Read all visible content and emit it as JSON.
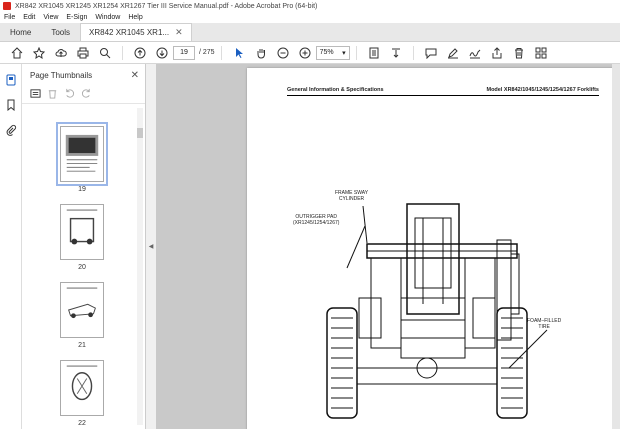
{
  "window": {
    "title": "XR842 XR1045 XR1245 XR1254 XR1267 Tier III Service Manual.pdf - Adobe Acrobat Pro (64-bit)"
  },
  "menu": [
    "File",
    "Edit",
    "View",
    "E-Sign",
    "Window",
    "Help"
  ],
  "tabs": {
    "home": "Home",
    "tools": "Tools",
    "document": "XR842 XR1045 XR1..."
  },
  "toolbar": {
    "current_page": "19",
    "total_pages": "/ 275",
    "zoom": "75%"
  },
  "panel": {
    "title": "Page Thumbnails",
    "thumbnails": [
      {
        "label": "19",
        "selected": true
      },
      {
        "label": "20",
        "selected": false
      },
      {
        "label": "21",
        "selected": false
      },
      {
        "label": "22",
        "selected": false
      }
    ]
  },
  "document_page": {
    "header_left": "General Information & Specifications",
    "header_right": "Model XR842/1045/1245/1254/1267 Forklifts",
    "callouts": {
      "frame_sway": [
        "FRAME SWAY",
        "CYLINDER"
      ],
      "outrigger": [
        "OUTRIGGER PAD",
        "(XR1245/1254/1267)"
      ],
      "foam_tire": [
        "FOAM–FILLED",
        "TIRE"
      ]
    }
  }
}
